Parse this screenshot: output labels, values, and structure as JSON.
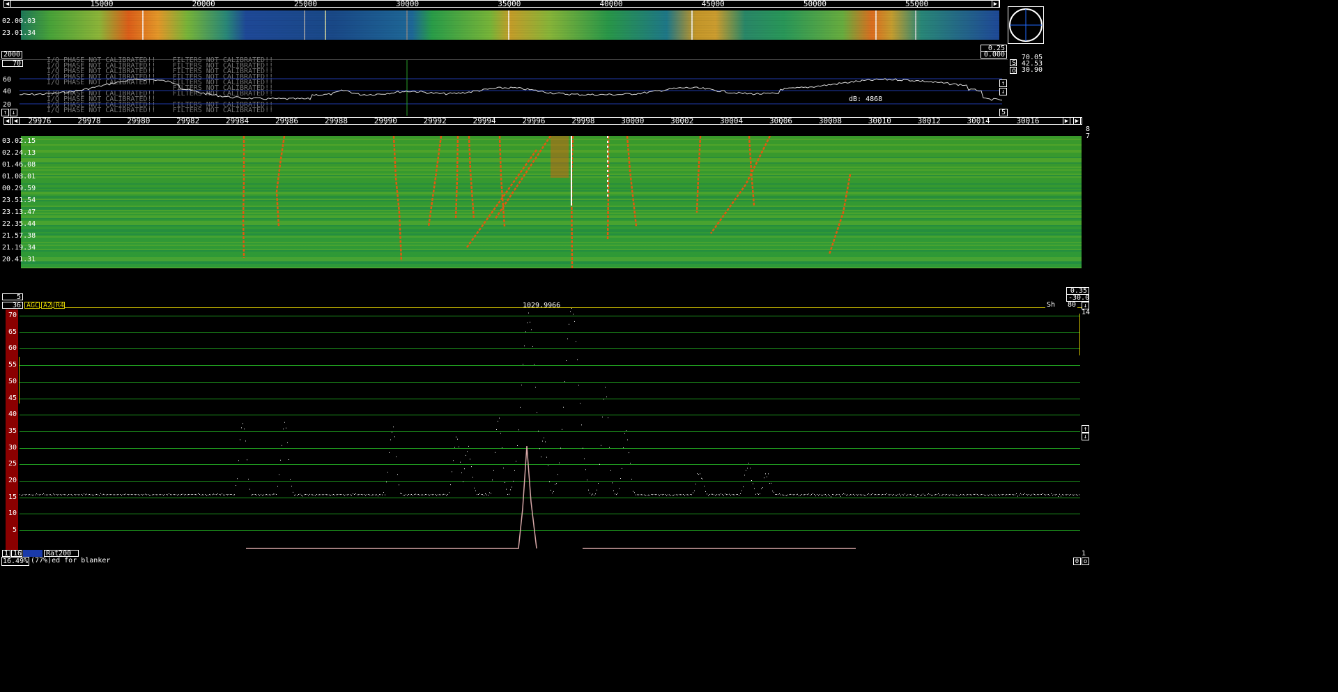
{
  "wide_ruler": {
    "labels": [
      "15000",
      "20000",
      "25000",
      "30000",
      "35000",
      "40000",
      "45000",
      "50000",
      "55000"
    ]
  },
  "wide_waterfall": {
    "timestamps": [
      "02.00.03",
      "23.01.34"
    ]
  },
  "wide_controls": {
    "left_value": "2000",
    "right_top": "0.25",
    "right_bottom": "0.000"
  },
  "spectrum_small": {
    "scale_box": "70",
    "ylabels": [
      "60",
      "40",
      "20"
    ],
    "warnings": [
      "I/Q PHASE NOT CALIBRATED!!    FILTERS NOT CALIBRATED!!",
      "I/Q PHASE NOT CALIBRATED!!    FILTERS NOT CALIBRATED!!",
      "I/Q PHASE NOT CALIBRATED!!    FILTERS NOT CALIBRATED!!",
      "I/Q PHASE NOT CALIBRATED!!    FILTERS NOT CALIBRATED!!",
      "I/Q PHASE NOT CALIBRATED!!    FILTERS NOT CALIBRATED!!",
      "                              FILTERS NOT CALIBRATED!!",
      "I/Q PHASE NOT CALIBRATED!!    FILTERS NOT CALIBRATED!!",
      "I/Q PHASE NOT CALIBRATED!!",
      "I/Q PHASE NOT CALIBRATED!!    FILTERS NOT CALIBRATED!!",
      "I/Q PHASE NOT CALIBRATED!!    FILTERS NOT CALIBRATED!!"
    ],
    "overlay_text": "dB: 4868",
    "down_box": "5"
  },
  "meter": {
    "values": [
      "70.05",
      "42.53",
      "30.90"
    ],
    "letters": [
      "S",
      "o"
    ]
  },
  "hires_ruler": {
    "labels": [
      "29976",
      "29978",
      "29980",
      "29982",
      "29984",
      "29986",
      "29988",
      "29990",
      "29992",
      "29994",
      "29996",
      "29998",
      "30000",
      "30002",
      "30004",
      "30006",
      "30008",
      "30010",
      "30012",
      "30014",
      "30016"
    ]
  },
  "hires_waterfall": {
    "timestamps": [
      "03.02.15",
      "02.24.13",
      "01.46.08",
      "01.08.01",
      "00.29.59",
      "23.51.54",
      "23.13.47",
      "22.35.44",
      "21.57.38",
      "21.19.34",
      "20.41.31"
    ],
    "right_marks": [
      "8",
      "7"
    ]
  },
  "hires_controls": {
    "left_box": "5",
    "right_top": "0.35",
    "right_bottom": "-30.0"
  },
  "baseband": {
    "left_num": "36",
    "agc": "AGC",
    "a2": "A2",
    "r4": "R4",
    "center_freq": "1029.9966",
    "sh_label": "Sh",
    "sh_value": "80",
    "right_num": "14",
    "ylabels": [
      "70",
      "65",
      "60",
      "55",
      "50",
      "45",
      "40",
      "35",
      "30",
      "25",
      "20",
      "15",
      "10",
      "5"
    ],
    "bottom_nums": [
      "1",
      "16"
    ],
    "rat": "Rat200",
    "corner": "1"
  },
  "status": {
    "percent": "16.49%",
    "text": "(77%)ed for blanker"
  },
  "colors": {
    "grid": "#1f9a1f",
    "bar": "#8b0000",
    "line": "#ffffff",
    "wf_green": "#2d9a1f",
    "wf_orange": "#e05a10"
  }
}
